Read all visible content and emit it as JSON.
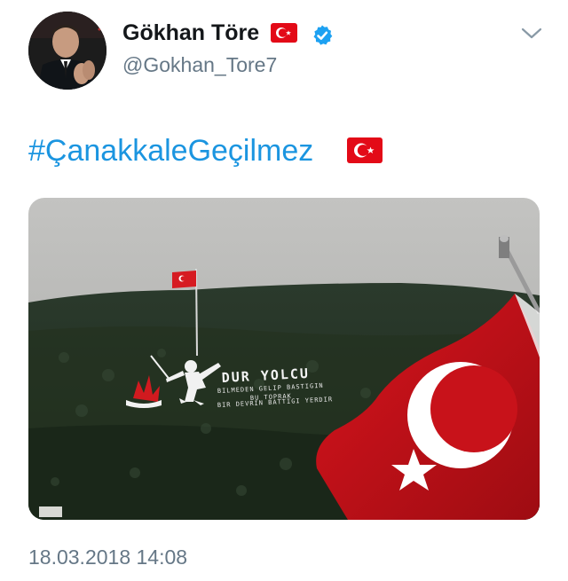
{
  "author": {
    "display_name": "Gökhan Töre",
    "handle": "@Gokhan_Tore7",
    "verified": true,
    "name_flag_icon": "turkey-flag-icon"
  },
  "tweet": {
    "text": "#ÇanakkaleGeçilmez",
    "text_flag_icon": "turkey-flag-icon",
    "link_color": "#1b95e0",
    "timestamp": "18.03.2018 14:08"
  },
  "media": {
    "hillside_lines": [
      "DUR YOLCU",
      "BILMEDEN GELIP BASTIGIN",
      "BU TOPRAK",
      "BIR DEVRIN BATTIGI YERDIR"
    ]
  },
  "colors": {
    "name": "#14171a",
    "secondary": "#657786",
    "verified": "#1da1f2",
    "flag_red": "#e30a17"
  }
}
